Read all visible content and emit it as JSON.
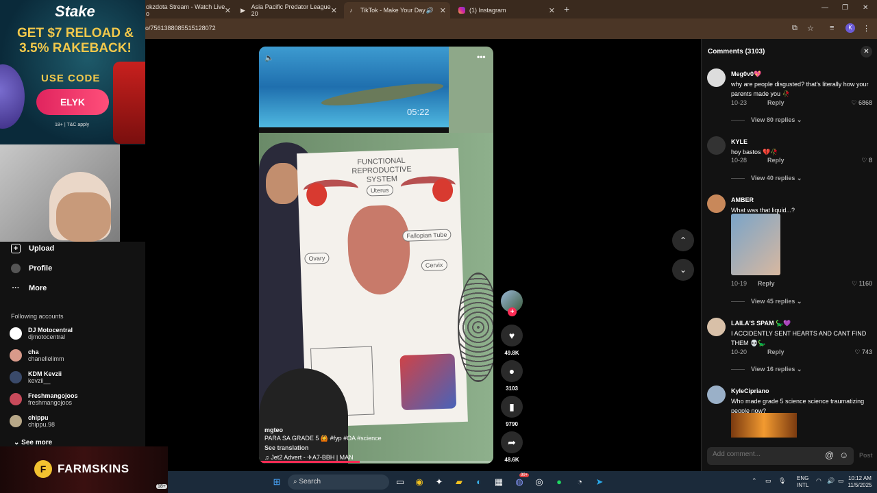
{
  "browser": {
    "tabs": [
      {
        "label": "okzdota Stream - Watch Live o",
        "close": "✕"
      },
      {
        "label": "Asia Pacific Predator League 20",
        "close": "✕"
      },
      {
        "label": "TikTok - Make Your Day",
        "close": "✕"
      },
      {
        "label": "(1) Instagram",
        "close": "✕"
      }
    ],
    "new_tab": "+",
    "url": "o/7561388085515128072",
    "profile_initial": "K"
  },
  "promo": {
    "brand": "Stake",
    "headline": "GET $7 RELOAD & 3.5% RAKEBACK!",
    "use_code": "USE CODE",
    "code": "ELYK",
    "terms": "18+ | T&C apply"
  },
  "sidebar": {
    "items": [
      {
        "label": "Upload",
        "icon": "upload-icon"
      },
      {
        "label": "Profile",
        "icon": "profile-icon"
      },
      {
        "label": "More",
        "icon": "more-icon"
      }
    ],
    "following_heading": "Following accounts",
    "accounts": [
      {
        "display": "DJ Motocentral",
        "user": "djmotocentral"
      },
      {
        "display": "cha",
        "user": "chanellelimm"
      },
      {
        "display": "KDM Kevzii",
        "user": "kevzii__"
      },
      {
        "display": "Freshmangojoos",
        "user": "freshmangojoos"
      },
      {
        "display": "chippu",
        "user": "chippu.98"
      }
    ],
    "see_more": "See more"
  },
  "farmskins": {
    "name": "FARMSKINS",
    "age": "18+"
  },
  "video": {
    "tv_time": "05:22",
    "poster_title": "FUNCTIONAL REPRODUCTIVE SYSTEM",
    "labels": {
      "uterus": "Uterus",
      "fallopian": "Fallopian Tube",
      "ovary": "Ovary",
      "cervix": "Cervix"
    },
    "author": "mgteo",
    "description": "PARA SA GRADE 5 🙆 #fyp #OA #science",
    "see_translation": "See translation",
    "music": "♫ Jet2 Advert - ✈A7-BBH | MAN",
    "progress_fraction": 0.43
  },
  "actions": {
    "likes": "49.8K",
    "comments": "3103",
    "saves": "9790",
    "shares": "48.6K"
  },
  "comments": {
    "header": "Comments (3103)",
    "reply_label": "Reply",
    "items": [
      {
        "user": "Meg0v0💖",
        "text": "why are people disgusted? that's literally how your parents made you 🥀",
        "date": "10-23",
        "likes": "6868",
        "view": "View 80 replies"
      },
      {
        "user": "KYLE",
        "text": "hoy bastos 💔🥀",
        "date": "10-28",
        "likes": "8",
        "view": "View 40 replies"
      },
      {
        "user": "AMBER",
        "text": "What was that liquid...?",
        "date": "10-19",
        "likes": "1160",
        "view": "View 45 replies"
      },
      {
        "user": "LAILA'S SPAM 🦕💜",
        "text": "I ACCIDENTLY SENT HEARTS AND CANT FIND THEM 💀🦕",
        "date": "10-20",
        "likes": "743",
        "view": "View 16 replies"
      },
      {
        "user": "KyleCipriano",
        "text": "Who made grade 5 science science traumatizing people now?",
        "date": "",
        "likes": "",
        "view": ""
      }
    ],
    "add_placeholder": "Add comment...",
    "post_label": "Post"
  },
  "taskbar": {
    "search": "Search",
    "lang": "ENG",
    "lang2": "INTL",
    "time": "10:12 AM",
    "date": "11/5/2025",
    "badge": "99+"
  }
}
